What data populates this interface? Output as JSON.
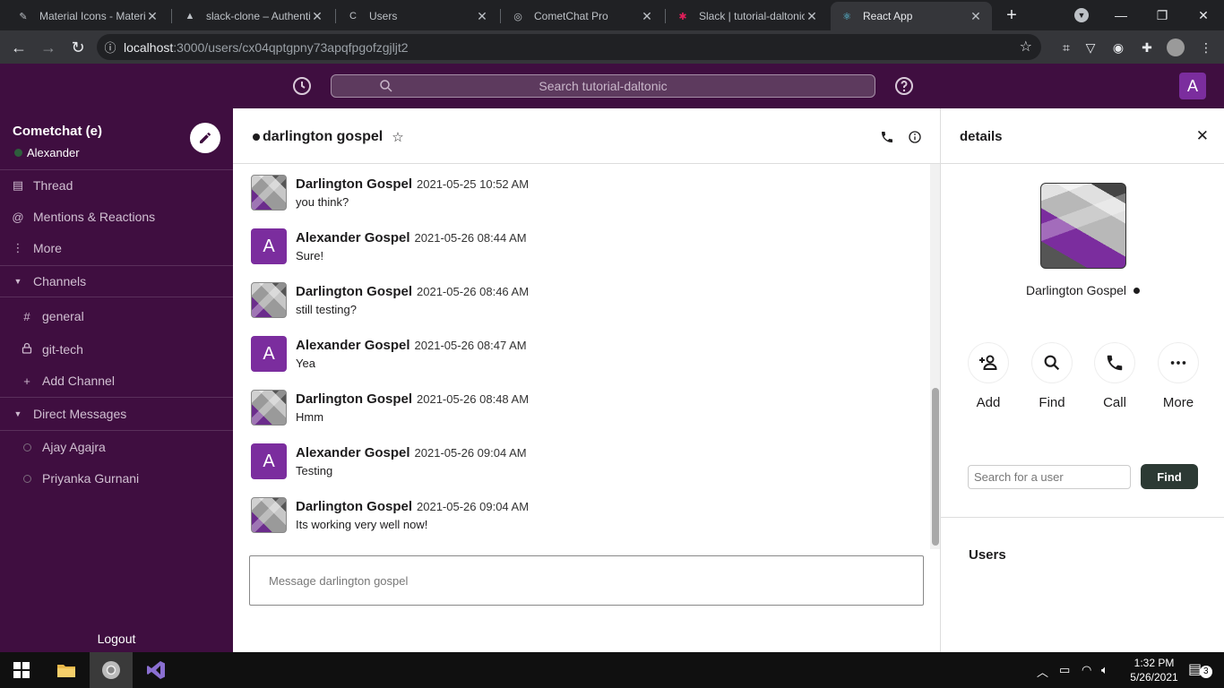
{
  "browser": {
    "tabs": [
      {
        "title": "Material Icons - Material Design",
        "favicon": "material-icon"
      },
      {
        "title": "slack-clone – Authentication",
        "favicon": "firebase-icon"
      },
      {
        "title": "Users",
        "favicon": "cometchat-icon"
      },
      {
        "title": "CometChat Pro",
        "favicon": "cometchat-icon"
      },
      {
        "title": "Slack | tutorial-daltonic",
        "favicon": "slack-icon"
      },
      {
        "title": "React App",
        "favicon": "react-icon"
      }
    ],
    "url_host": "localhost",
    "url_rest": ":3000/users/cx04qptgpny73apqfpgofzgjljt2"
  },
  "appbar": {
    "search_placeholder": "Search tutorial-daltonic",
    "avatar_letter": "A"
  },
  "sidebar": {
    "workspace": "Cometchat (e)",
    "user": "Alexander",
    "nav": [
      {
        "label": "Thread",
        "icon": "thread-icon"
      },
      {
        "label": "Mentions & Reactions",
        "icon": "at-icon"
      },
      {
        "label": "More",
        "icon": "more-vert-icon"
      }
    ],
    "channels_header": "Channels",
    "channels": [
      {
        "label": "general",
        "icon": "hash-icon"
      },
      {
        "label": "git-tech",
        "icon": "lock-icon"
      }
    ],
    "add_channel": "Add Channel",
    "dm_header": "Direct Messages",
    "dms": [
      "Ajay Agajra",
      "Priyanka Gurnani"
    ],
    "logout": "Logout"
  },
  "chat": {
    "title": "darlington gospel",
    "messages": [
      {
        "author": "Darlington Gospel",
        "time": "2021-05-25 10:52 AM",
        "text": "you think?",
        "avatar": "photo"
      },
      {
        "author": "Alexander Gospel",
        "time": "2021-05-26 08:44 AM",
        "text": "Sure!",
        "avatar": "A"
      },
      {
        "author": "Darlington Gospel",
        "time": "2021-05-26 08:46 AM",
        "text": "still testing?",
        "avatar": "photo"
      },
      {
        "author": "Alexander Gospel",
        "time": "2021-05-26 08:47 AM",
        "text": "Yea",
        "avatar": "A"
      },
      {
        "author": "Darlington Gospel",
        "time": "2021-05-26 08:48 AM",
        "text": "Hmm",
        "avatar": "photo"
      },
      {
        "author": "Alexander Gospel",
        "time": "2021-05-26 09:04 AM",
        "text": "Testing",
        "avatar": "A"
      },
      {
        "author": "Darlington Gospel",
        "time": "2021-05-26 09:04 AM",
        "text": "Its working very well now!",
        "avatar": "photo"
      }
    ],
    "composer_placeholder": "Message darlington gospel"
  },
  "details": {
    "title": "details",
    "name": "Darlington Gospel",
    "actions": [
      {
        "label": "Add",
        "icon": "person-add-icon"
      },
      {
        "label": "Find",
        "icon": "search-icon"
      },
      {
        "label": "Call",
        "icon": "phone-icon"
      },
      {
        "label": "More",
        "icon": "more-horiz-icon"
      }
    ],
    "user_search_placeholder": "Search for a user",
    "find_button": "Find",
    "users_heading": "Users"
  },
  "taskbar": {
    "time": "1:32 PM",
    "date": "5/26/2021",
    "notifications": "3"
  },
  "colors": {
    "sidebar_bg": "#3f0e40",
    "avatar_purple": "#7b2d9e",
    "find_button_bg": "#2c3a34"
  }
}
